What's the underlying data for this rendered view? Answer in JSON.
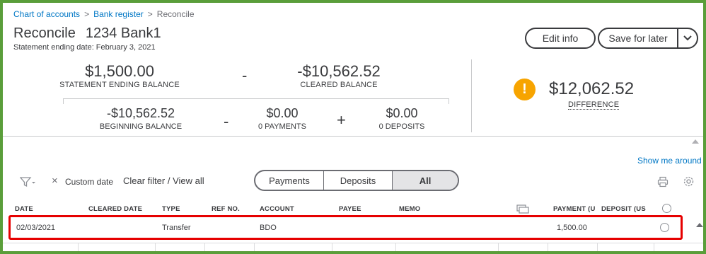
{
  "breadcrumb": {
    "items": [
      "Chart of accounts",
      "Bank register",
      "Reconcile"
    ],
    "separator": ">"
  },
  "header": {
    "title": "Reconcile",
    "account": "1234 Bank1",
    "subtitle": "Statement ending date: February 3, 2021"
  },
  "buttons": {
    "edit_info": "Edit info",
    "save_for_later": "Save for later"
  },
  "summary": {
    "statement_ending_balance": "$1,500.00",
    "statement_ending_balance_label": "STATEMENT ENDING BALANCE",
    "minus_1": "-",
    "cleared_balance": "-$10,562.52",
    "cleared_balance_label": "CLEARED BALANCE",
    "beginning_balance": "-$10,562.52",
    "beginning_balance_label": "BEGINNING BALANCE",
    "minus_2": "-",
    "payments": "$0.00",
    "payments_label": "0 PAYMENTS",
    "plus": "+",
    "deposits": "$0.00",
    "deposits_label": "0 DEPOSITS",
    "warning_glyph": "!",
    "difference": "$12,062.52",
    "difference_label": "DIFFERENCE"
  },
  "help": {
    "show_me_around": "Show me around"
  },
  "filters": {
    "clear_glyph": "×",
    "custom_date": "Custom date",
    "clear_filter": "Clear filter / View all"
  },
  "tabs": {
    "payments": "Payments",
    "deposits": "Deposits",
    "all": "All"
  },
  "table": {
    "headers": {
      "date": "DATE",
      "cleared_date": "CLEARED DATE",
      "type": "TYPE",
      "ref_no": "REF NO.",
      "account": "ACCOUNT",
      "payee": "PAYEE",
      "memo": "MEMO",
      "payment": "PAYMENT (U",
      "deposit": "DEPOSIT (US"
    },
    "rows": [
      {
        "date": "02/03/2021",
        "cleared_date": "",
        "type": "Transfer",
        "ref_no": "",
        "account": "BDO",
        "payee": "",
        "memo": "",
        "payment": "1,500.00",
        "deposit": ""
      }
    ]
  },
  "colors": {
    "frame": "#5a9e3a",
    "link": "#0077c5",
    "warning": "#f7a400",
    "highlight": "#e60000",
    "text": "#393a3d"
  }
}
